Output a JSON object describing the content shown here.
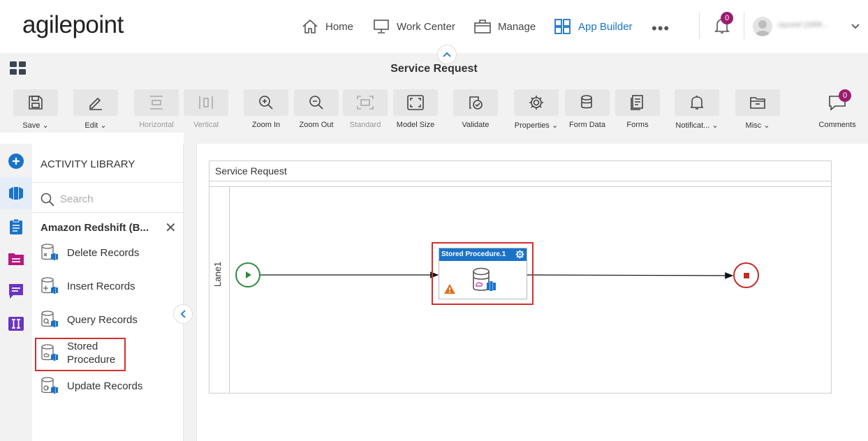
{
  "brand": {
    "logo_text": "agilepoint"
  },
  "nav": {
    "home": "Home",
    "work_center": "Work Center",
    "manage": "Manage",
    "app_builder": "App Builder",
    "more": "•••"
  },
  "notifications": {
    "count": "0"
  },
  "user": {
    "name": "razorel (SRR..."
  },
  "page": {
    "title": "Service Request"
  },
  "toolbar": {
    "save": "Save",
    "edit": "Edit",
    "horizontal": "Horizontal",
    "vertical": "Vertical",
    "zoom_in": "Zoom In",
    "zoom_out": "Zoom Out",
    "standard": "Standard",
    "model_size": "Model Size",
    "validate": "Validate",
    "properties": "Properties",
    "form_data": "Form Data",
    "forms": "Forms",
    "notifications": "Notificat...",
    "misc": "Misc",
    "comments": "Comments",
    "comments_count": "0"
  },
  "library": {
    "heading": "ACTIVITY LIBRARY",
    "search_placeholder": "Search",
    "category": "Amazon Redshift (B...",
    "items": [
      {
        "label": "Delete Records"
      },
      {
        "label": "Insert Records"
      },
      {
        "label": "Query Records"
      },
      {
        "label": "Stored Procedure"
      },
      {
        "label": "Update Records"
      }
    ]
  },
  "diagram": {
    "pool_title": "Service Request",
    "lane_label": "Lane1",
    "activity_title": "Stored Procedure.1"
  },
  "colors": {
    "accent": "#1a73c9",
    "badge": "#9b1c6e",
    "start": "#2e8b3e",
    "end": "#c62828",
    "highlight": "#d32f2f",
    "warning": "#e07020"
  }
}
